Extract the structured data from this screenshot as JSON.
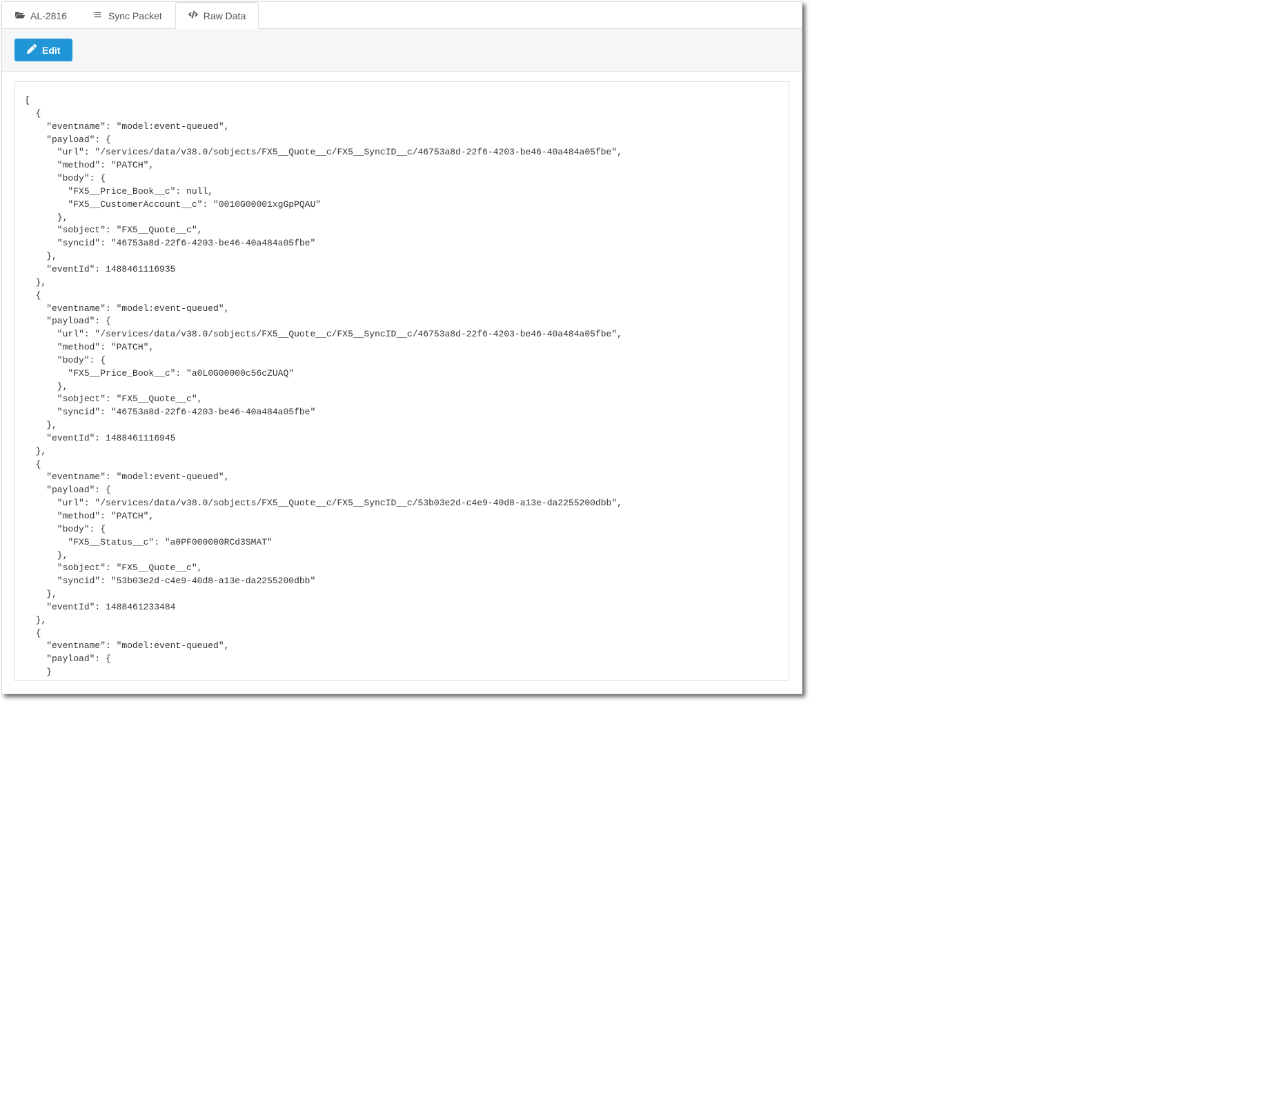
{
  "tabs": [
    {
      "label": "AL-2816",
      "icon": "folder-open"
    },
    {
      "label": "Sync Packet",
      "icon": "list"
    },
    {
      "label": "Raw Data",
      "icon": "code"
    }
  ],
  "activeTab": 2,
  "toolbar": {
    "edit_label": "Edit"
  },
  "raw_data": [
    {
      "eventname": "model:event-queued",
      "payload": {
        "url": "/services/data/v38.0/sobjects/FX5__Quote__c/FX5__SyncID__c/46753a8d-22f6-4203-be46-40a484a05fbe",
        "method": "PATCH",
        "body": {
          "FX5__Price_Book__c": null,
          "FX5__CustomerAccount__c": "0010G00001xgGpPQAU"
        },
        "sobject": "FX5__Quote__c",
        "syncid": "46753a8d-22f6-4203-be46-40a484a05fbe"
      },
      "eventId": 1488461116935
    },
    {
      "eventname": "model:event-queued",
      "payload": {
        "url": "/services/data/v38.0/sobjects/FX5__Quote__c/FX5__SyncID__c/46753a8d-22f6-4203-be46-40a484a05fbe",
        "method": "PATCH",
        "body": {
          "FX5__Price_Book__c": "a0L0G00000c56cZUAQ"
        },
        "sobject": "FX5__Quote__c",
        "syncid": "46753a8d-22f6-4203-be46-40a484a05fbe"
      },
      "eventId": 1488461116945
    },
    {
      "eventname": "model:event-queued",
      "payload": {
        "url": "/services/data/v38.0/sobjects/FX5__Quote__c/FX5__SyncID__c/53b03e2d-c4e9-40d8-a13e-da2255200dbb",
        "method": "PATCH",
        "body": {
          "FX5__Status__c": "a0PF000000RCd3SMAT"
        },
        "sobject": "FX5__Quote__c",
        "syncid": "53b03e2d-c4e9-40d8-a13e-da2255200dbb"
      },
      "eventId": 1488461233484
    },
    {
      "eventname": "model:event-queued",
      "payload": {}
    }
  ]
}
